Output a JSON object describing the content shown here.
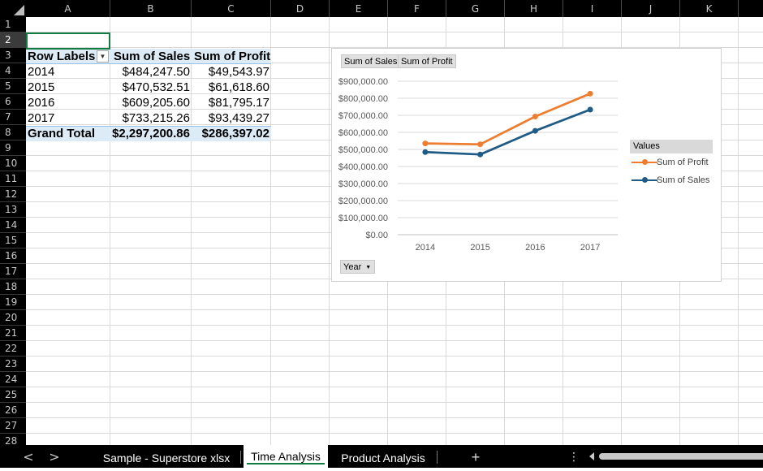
{
  "columns": [
    "A",
    "B",
    "C",
    "D",
    "E",
    "F",
    "G",
    "H",
    "I",
    "J",
    "K"
  ],
  "rows": [
    "1",
    "2",
    "3",
    "4",
    "5",
    "6",
    "7",
    "8",
    "9",
    "10",
    "11",
    "12",
    "13",
    "14",
    "15",
    "16",
    "17",
    "18",
    "19",
    "20",
    "21",
    "22",
    "23",
    "24",
    "25",
    "26",
    "27",
    "28"
  ],
  "pivot": {
    "header": {
      "row_labels": "Row Labels",
      "sum_sales": "Sum of Sales",
      "sum_profit": "Sum of Profit"
    },
    "rows": [
      {
        "label": "2014",
        "sales": "$484,247.50",
        "profit": "$49,543.97"
      },
      {
        "label": "2015",
        "sales": "$470,532.51",
        "profit": "$61,618.60"
      },
      {
        "label": "2016",
        "sales": "$609,205.60",
        "profit": "$81,795.17"
      },
      {
        "label": "2017",
        "sales": "$733,215.26",
        "profit": "$93,439.27"
      }
    ],
    "total": {
      "label": "Grand Total",
      "sales": "$2,297,200.86",
      "profit": "$286,397.02"
    },
    "filter_icon": "dropdown-arrow-icon"
  },
  "chart": {
    "field_buttons": [
      "Sum of Sales",
      "Sum of Profit"
    ],
    "axis_button": "Year",
    "legend_title": "Values",
    "legend": [
      {
        "name": "Sum of Profit",
        "color": "#ed7d31"
      },
      {
        "name": "Sum of Sales",
        "color": "#1f5c85"
      }
    ]
  },
  "chart_data": {
    "type": "line",
    "categories": [
      "2014",
      "2015",
      "2016",
      "2017"
    ],
    "series": [
      {
        "name": "Sum of Profit",
        "color": "#ed7d31",
        "values": [
          535000,
          530000,
          693000,
          827000
        ]
      },
      {
        "name": "Sum of Sales",
        "color": "#1f5c85",
        "values": [
          484247.5,
          470532.51,
          609205.6,
          733215.26
        ]
      }
    ],
    "ylim": [
      0,
      900000
    ],
    "yticks": [
      "$0.00",
      "$100,000.00",
      "$200,000.00",
      "$300,000.00",
      "$400,000.00",
      "$500,000.00",
      "$600,000.00",
      "$700,000.00",
      "$800,000.00",
      "$900,000.00"
    ],
    "grid": true,
    "legend_position": "right"
  },
  "tabs": {
    "items": [
      "Sample - Superstore xlsx",
      "Time Analysis",
      "Product Analysis"
    ],
    "active": "Time Analysis",
    "add_label": "+",
    "more_label": "⋮",
    "prev_label": "<",
    "next_label": ">"
  }
}
